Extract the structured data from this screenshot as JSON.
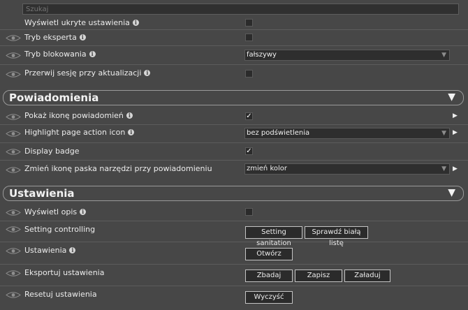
{
  "search": {
    "placeholder": "Szukaj"
  },
  "general": {
    "show_hidden_label": "Wyświetl ukryte ustawienia",
    "expert_mode_label": "Tryb eksperta",
    "lock_mode_label": "Tryb blokowania",
    "lock_mode_value": "fałszywy",
    "break_session_label": "Przerwij sesję przy aktualizacji"
  },
  "notifications": {
    "title": "Powiadomienia",
    "show_icon_label": "Pokaż ikonę powiadomień",
    "highlight_label": "Highlight page action icon",
    "highlight_value": "bez podświetlenia",
    "display_badge_label": "Display badge",
    "toolbar_icon_label": "Zmień ikonę paska narzędzi przy powiadomieniu",
    "toolbar_icon_value": "zmień kolor"
  },
  "settings": {
    "title": "Ustawienia",
    "show_desc_label": "Wyświetl opis",
    "setting_controlling_label": "Setting controlling",
    "sanitation_button": "Setting sanitation",
    "whitelist_button": "Sprawdź białą listę",
    "settings_label": "Ustawienia",
    "open_button": "Otwórz",
    "export_label": "Eksportuj ustawienia",
    "save_button": "Zbadaj",
    "write_button": "Zapisz",
    "load_button": "Załaduj",
    "reset_label": "Resetuj ustawienia",
    "clear_button": "Wyczyść"
  },
  "glyphs": {
    "info": "i",
    "check": "✓",
    "caret": "▼",
    "triangle": "▼",
    "arrow_right": "▶"
  }
}
